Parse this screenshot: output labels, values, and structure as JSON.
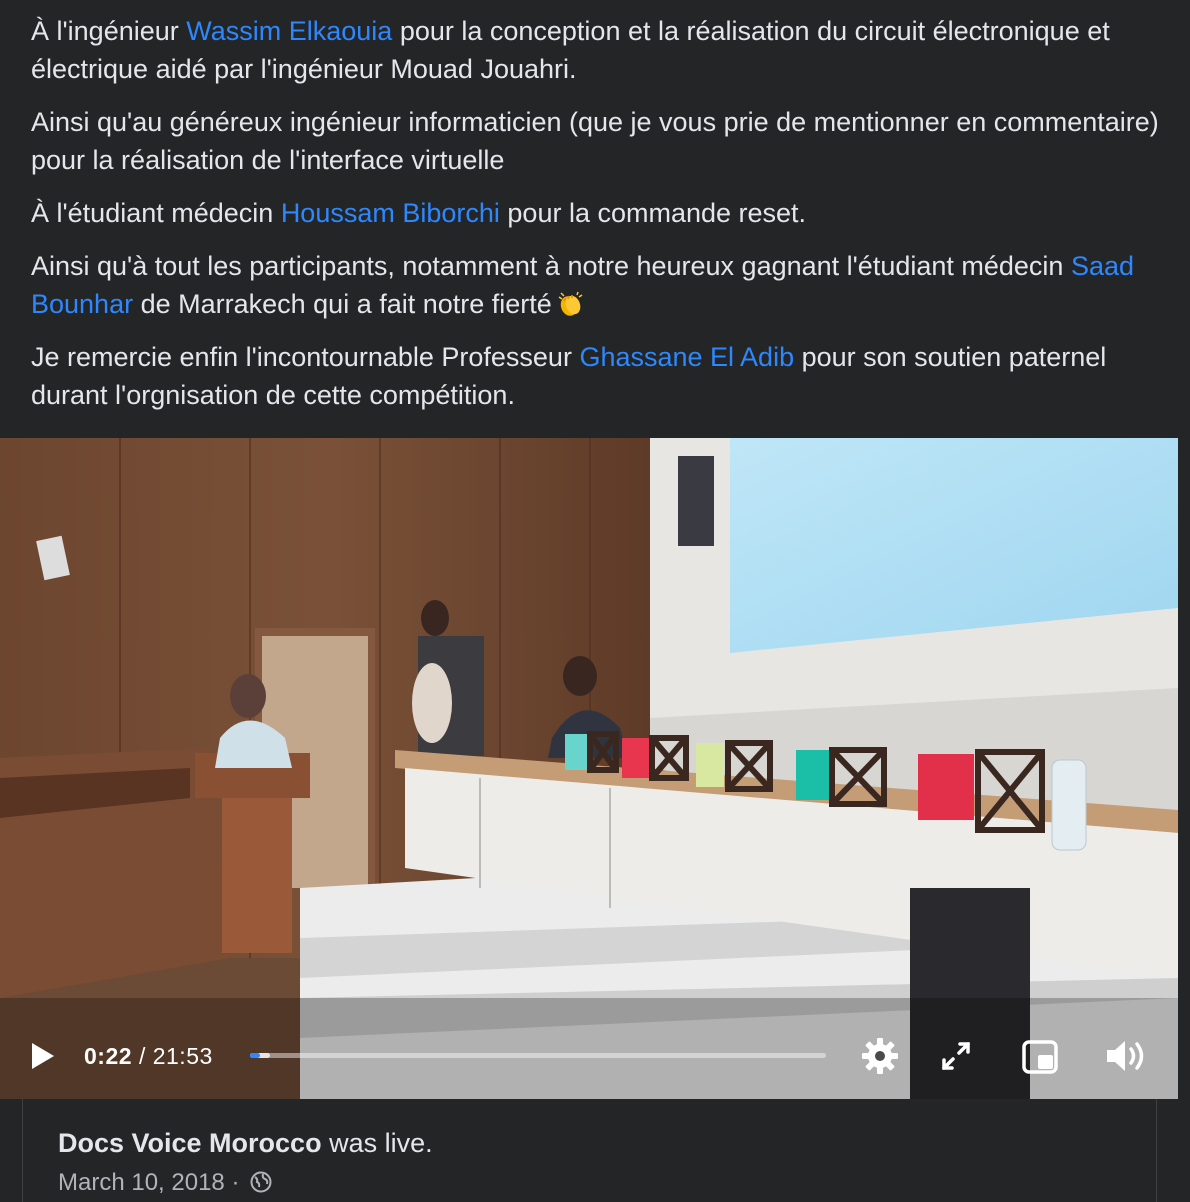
{
  "post": {
    "p1": {
      "a": "À l'ingénieur ",
      "m": "Wassim Elkaouia",
      "b": " pour la conception et la réalisation du circuit électronique et électrique aidé par l'ingénieur Mouad Jouahri."
    },
    "p2": {
      "a": "Ainsi qu'au généreux ingénieur informaticien (que je vous prie de mentionner en commentaire) pour la réalisation de l'interface virtuelle"
    },
    "p3": {
      "a": "À l'étudiant médecin ",
      "m": "Houssam Biborchi",
      "b": " pour la commande reset."
    },
    "p4": {
      "a": "Ainsi qu'à tout les participants, notamment à notre heureux gagnant l'étudiant médecin ",
      "m": "Saad Bounhar",
      "b": " de Marrakech qui a fait notre fierté"
    },
    "p5": {
      "a": "Je remercie enfin l'incontournable Professeur ",
      "m": "Ghassane El Adib",
      "b": " pour son soutien paternel durant l'orgnisation de cette compétition."
    },
    "emoji": "clapping-hands",
    "mention_color": "#2d88ff"
  },
  "video": {
    "current_time": "0:22",
    "separator": "/",
    "duration": "21:53",
    "progress": 0.017,
    "buffered": 0.035,
    "icons": [
      "play-icon",
      "settings-gear-icon",
      "fullscreen-icon",
      "picture-in-picture-icon",
      "volume-icon"
    ]
  },
  "footer": {
    "page_name": "Docs Voice Morocco",
    "status": " was live.",
    "date": "March 10, 2018",
    "dot": " · ",
    "privacy_icon": "globe-icon"
  }
}
